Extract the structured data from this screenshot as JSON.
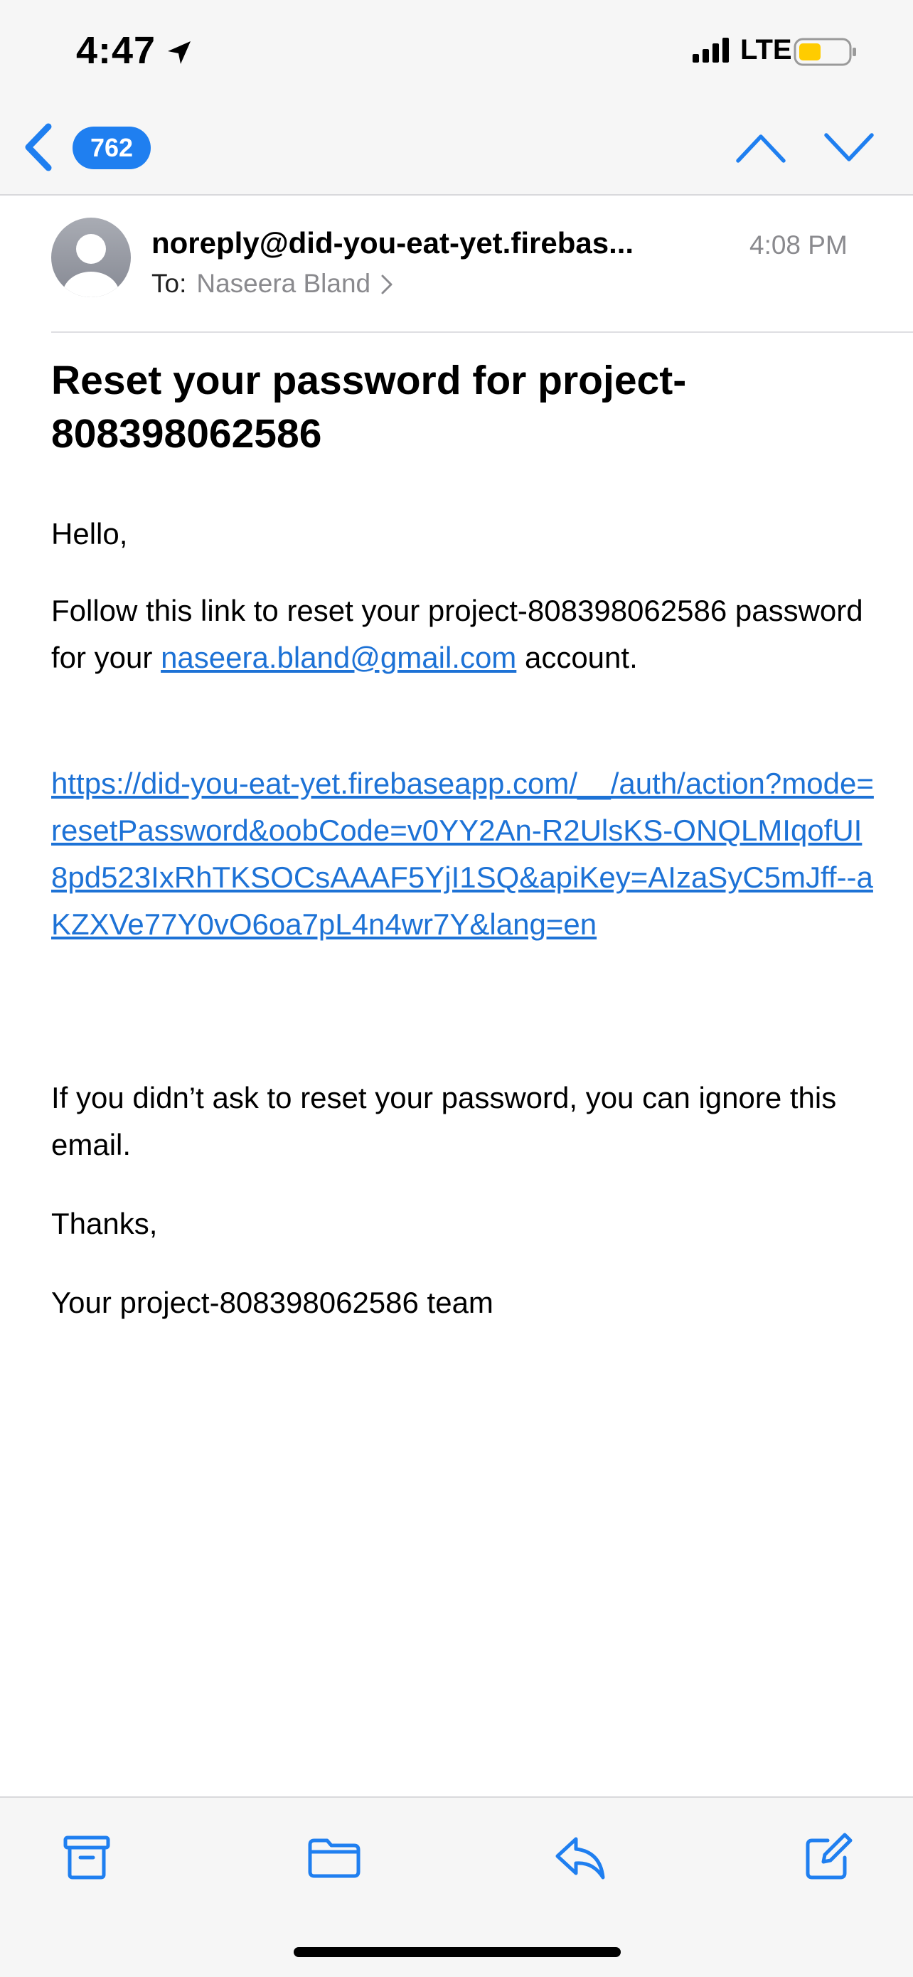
{
  "status_bar": {
    "time": "4:47",
    "network": "LTE"
  },
  "nav": {
    "unread_count": "762"
  },
  "message": {
    "sender": "noreply@did-you-eat-yet.firebas...",
    "time": "4:08 PM",
    "to_label": "To:",
    "to_name": "Naseera Bland",
    "subject": "Reset your password for project-808398062586",
    "greeting": "Hello,",
    "para1_before": "Follow this link to reset your project-808398062586 password for your ",
    "para1_email": "naseera.bland@gmail.com",
    "para1_after": " account.",
    "reset_url": "https://did-you-eat-yet.firebaseapp.com/__/auth/action?mode=resetPassword&oobCode=v0YY2An-R2UlsKS-ONQLMIqofUI8pd523IxRhTKSOCsAAAF5YjI1SQ&apiKey=AIzaSyC5mJff--aKZXVe77Y0vO6oa7pL4n4wr7Y&lang=en",
    "para2": "If you didn’t ask to reset your password, you can ignore this email.",
    "thanks": "Thanks,",
    "signoff": "Your project-808398062586 team"
  },
  "toolbar": {
    "icons": [
      "archive-icon",
      "folder-icon",
      "reply-icon",
      "compose-icon"
    ]
  },
  "colors": {
    "accent": "#1f7ff0",
    "link": "#1d72d6",
    "secondary_text": "#8a8a8e"
  }
}
